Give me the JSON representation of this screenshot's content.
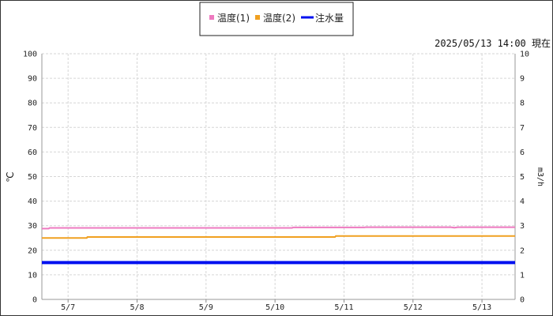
{
  "status": {
    "text": "2025/05/13 14:00 現在"
  },
  "chart_data": {
    "type": "line",
    "x_tick_labels": [
      "5/7",
      "5/8",
      "5/9",
      "5/10",
      "5/11",
      "5/12",
      "5/13"
    ],
    "y_left": {
      "label": "℃",
      "range": [
        0,
        100
      ],
      "ticks": [
        0,
        10,
        20,
        30,
        40,
        50,
        60,
        70,
        80,
        90,
        100
      ]
    },
    "y_right": {
      "label": "m3/h",
      "range": [
        0,
        10
      ],
      "ticks": [
        0,
        1,
        2,
        3,
        4,
        5,
        6,
        7,
        8,
        9,
        10
      ]
    },
    "grid": true,
    "legend_position": "top-center",
    "x_range_days": [
      -0.38,
      6.48
    ],
    "series": [
      {
        "name": "温度(1)",
        "axis": "left",
        "color": "#ee7ac0",
        "points": [
          [
            -0.38,
            28.8
          ],
          [
            -0.28,
            28.8
          ],
          [
            -0.27,
            29.1
          ],
          [
            3.25,
            29.1
          ],
          [
            3.26,
            29.3
          ],
          [
            4.3,
            29.3
          ],
          [
            4.31,
            29.4
          ],
          [
            5.55,
            29.4
          ],
          [
            5.6,
            29.2
          ],
          [
            5.65,
            29.4
          ],
          [
            6.48,
            29.4
          ]
        ]
      },
      {
        "name": "温度(2)",
        "axis": "left",
        "color": "#f0a020",
        "points": [
          [
            -0.38,
            25.0
          ],
          [
            0.27,
            25.0
          ],
          [
            0.28,
            25.4
          ],
          [
            3.87,
            25.4
          ],
          [
            3.88,
            25.8
          ],
          [
            6.48,
            25.8
          ]
        ]
      },
      {
        "name": "注水量",
        "axis": "right",
        "color": "#0010f0",
        "points": [
          [
            -0.38,
            1.5
          ],
          [
            6.48,
            1.5
          ]
        ]
      }
    ]
  }
}
